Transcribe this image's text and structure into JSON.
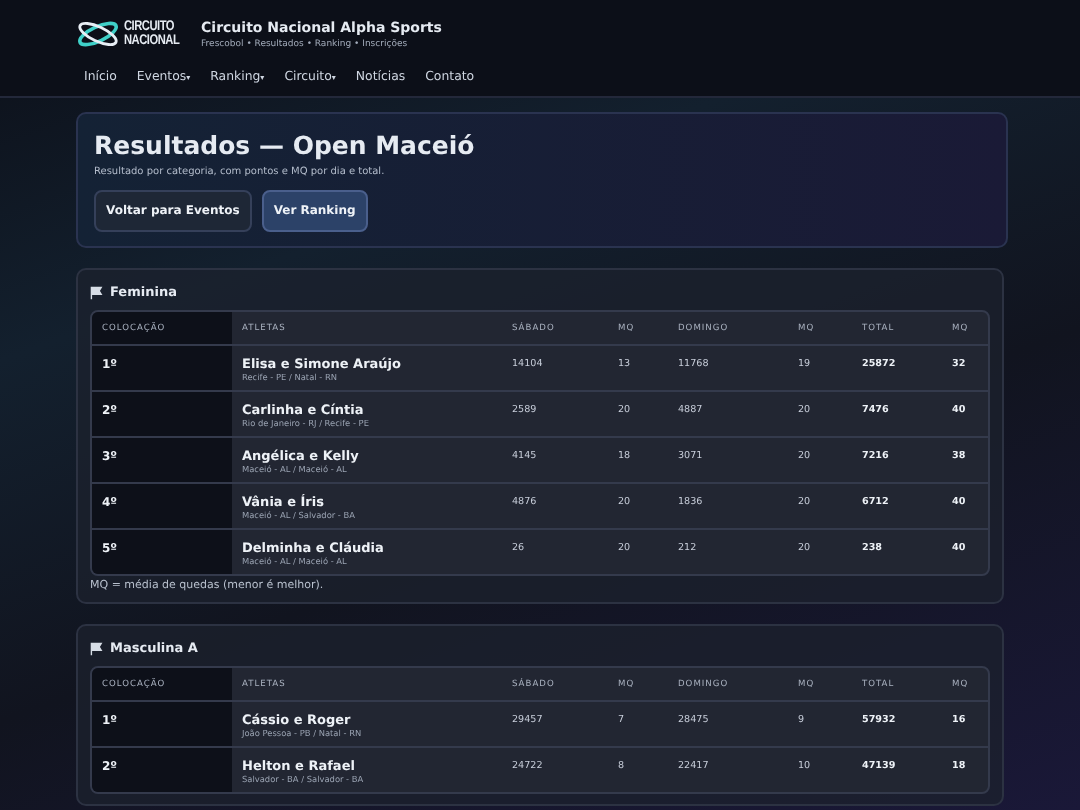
{
  "brand": {
    "logo_lines": [
      "CIRCUITO",
      "NACIONAL"
    ],
    "title": "Circuito Nacional Alpha Sports",
    "subtitle": "Frescobol • Resultados • Ranking • Inscrições"
  },
  "nav": [
    {
      "label": "Início"
    },
    {
      "label": "Eventos",
      "caret": "▾"
    },
    {
      "label": "Ranking",
      "caret": "▾"
    },
    {
      "label": "Circuito",
      "caret": "▾"
    },
    {
      "label": "Notícias"
    },
    {
      "label": "Contato"
    }
  ],
  "hero": {
    "title": "Resultados — Open Maceió",
    "subtitle": "Resultado por categoria, com pontos e MQ por dia e total.",
    "buttons": [
      {
        "label": "Voltar para Eventos",
        "kind": "secondary"
      },
      {
        "label": "Ver Ranking",
        "kind": "primary"
      }
    ]
  },
  "sections": [
    {
      "title": "Feminina",
      "columns": [
        "COLOCAÇÃO",
        "ATLETAS",
        "SÁBADO",
        "MQ",
        "DOMINGO",
        "MQ",
        "TOTAL",
        "MQ"
      ],
      "rows": [
        [
          "1º",
          {
            "names": "Elisa e Simone Araújo",
            "cities": "Recife - PE / Natal - RN"
          },
          "14104",
          "13",
          "11768",
          "19",
          "25872",
          "32"
        ],
        [
          "2º",
          {
            "names": "Carlinha e Cíntia",
            "cities": "Rio de Janeiro - RJ / Recife - PE"
          },
          "2589",
          "20",
          "4887",
          "20",
          "7476",
          "40"
        ],
        [
          "3º",
          {
            "names": "Angélica e Kelly",
            "cities": "Maceió - AL / Maceió - AL"
          },
          "4145",
          "18",
          "3071",
          "20",
          "7216",
          "38"
        ],
        [
          "4º",
          {
            "names": "Vânia e Íris",
            "cities": "Maceió - AL / Salvador - BA"
          },
          "4876",
          "20",
          "1836",
          "20",
          "6712",
          "40"
        ],
        [
          "5º",
          {
            "names": "Delminha e Cláudia",
            "cities": "Maceió - AL / Maceió - AL"
          },
          "26",
          "20",
          "212",
          "20",
          "238",
          "40"
        ]
      ],
      "note": "MQ = média de quedas (menor é melhor)."
    },
    {
      "title": "Masculina A",
      "columns": [
        "COLOCAÇÃO",
        "ATLETAS",
        "SÁBADO",
        "MQ",
        "DOMINGO",
        "MQ",
        "TOTAL",
        "MQ"
      ],
      "rows": [
        [
          "1º",
          {
            "names": "Cássio e Roger",
            "cities": "João Pessoa - PB / Natal - RN"
          },
          "29457",
          "7",
          "28475",
          "9",
          "57932",
          "16"
        ],
        [
          "2º",
          {
            "names": "Helton e Rafael",
            "cities": "Salvador - BA / Salvador - BA"
          },
          "24722",
          "8",
          "22417",
          "10",
          "47139",
          "18"
        ]
      ]
    }
  ]
}
